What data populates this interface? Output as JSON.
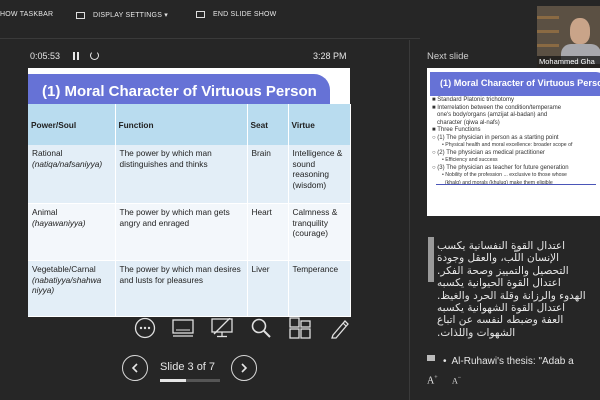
{
  "toolbar": {
    "show_taskbar": "HOW TASKBAR",
    "display_settings": "DISPLAY SETTINGS ▾",
    "end_slide_show": "END SLIDE SHOW"
  },
  "timer": {
    "elapsed": "0:05:53",
    "clock": "3:28 PM"
  },
  "slide": {
    "title": "(1) Moral Character of Virtuous Person",
    "headers": [
      "Power/Soul",
      "Function",
      "Seat",
      "Virtue"
    ],
    "rows": [
      {
        "soul": "Rational",
        "soul_term": "(natiqa/nafsaniyya)",
        "function": "The power by which man distinguishes and thinks",
        "seat": "Brain",
        "virtue": "Intelligence & sound reasoning (wisdom)"
      },
      {
        "soul": "Animal",
        "soul_term": "(hayawaniyya)",
        "function": "The power by which man gets angry and enraged",
        "seat": "Heart",
        "virtue": "Calmness & tranquility (courage)"
      },
      {
        "soul": "Vegetable/Carnal",
        "soul_term": "(nabatiyya/shahwa niyya)",
        "function": "The power by which man desires and lusts for pleasures",
        "seat": "Liver",
        "virtue": "Temperance"
      }
    ]
  },
  "navigation": {
    "slide_label": "Slide 3 of 7",
    "current": 3,
    "total": 7,
    "progress": 0.43
  },
  "next_slide": {
    "label": "Next slide",
    "title": "(1) Moral Character of Virtuous Person",
    "items": [
      "Standard Platonic trichotomy",
      "Interrelation between the condition/temperame",
      "one's body/organs (amzijat al-badan) and",
      "character (qiwa al-nafs)",
      "Three Functions",
      "(1) The physician in person as a starting point",
      "Physical health and moral excellence: broader scope of",
      "(2) The physician as medical practitioner",
      "Efficiency and success",
      "(3) The physician as teacher for future generation",
      "Nobility of the profession ... exclusive to those whose",
      "(khalq) and morals (khuluq) make them eligible"
    ]
  },
  "video": {
    "name": "Mohammed Gha"
  },
  "notes": {
    "lines": [
      "اعتدال القوة النفسانية يكسب",
      "الإنسان اللّب، والعقل وجودة",
      "التحصيل والتمييز وصحة الفكر.",
      "اعتدال القوة الحيوانية يكسبه",
      "الهدوء والرزانة وقلة الحرد والغيظ.",
      "اعتدال القوة الشهوانية يكسبه",
      "العفة وضبطه لنفسه عن اتباع",
      "الشهوات واللذات."
    ],
    "bullet": "Al-Ruhawi's thesis: \"Adab a"
  },
  "font_controls": {
    "increase": "A",
    "decrease": "A"
  }
}
